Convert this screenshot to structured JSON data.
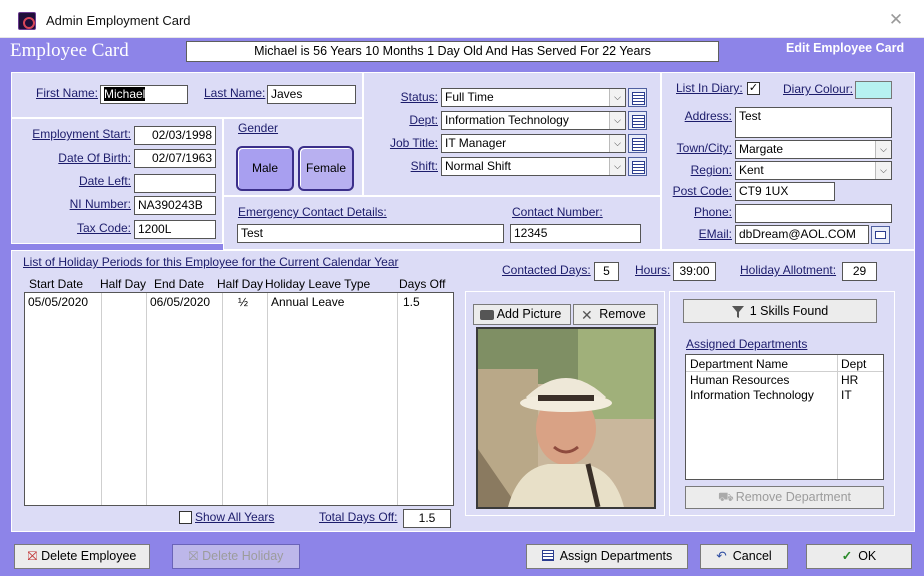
{
  "window": {
    "title": "Admin Employment Card"
  },
  "header": {
    "title": "Employee Card",
    "message": "Michael is 56 Years 10 Months 1 Day Old And Has Served For 22 Years",
    "mode": "Edit Employee Card"
  },
  "names": {
    "first_label": "First Name:",
    "first_value": "Michael",
    "last_label": "Last Name:",
    "last_value": "Javes"
  },
  "employment": {
    "start_label": "Employment Start:",
    "start_value": "02/03/1998",
    "dob_label": "Date Of Birth:",
    "dob_value": "02/07/1963",
    "left_label": "Date Left:",
    "left_value": "",
    "ni_label": "NI Number:",
    "ni_value": "NA390243B",
    "tax_label": "Tax Code:",
    "tax_value": "1200L"
  },
  "gender": {
    "label": "Gender",
    "male": "Male",
    "female": "Female",
    "selected": "Male"
  },
  "job": {
    "status_label": "Status:",
    "status_value": "Full Time",
    "dept_label": "Dept:",
    "dept_value": "Information Technology",
    "title_label": "Job Title:",
    "title_value": "IT Manager",
    "shift_label": "Shift:",
    "shift_value": "Normal Shift"
  },
  "emergency": {
    "contact_label": "Emergency Contact Details:",
    "contact_value": "Test",
    "number_label": "Contact Number:",
    "number_value": "12345"
  },
  "address": {
    "diary_label": "List In Diary:",
    "diary_checked": true,
    "colour_label": "Diary Colour:",
    "colour_value": "#b6f1f1",
    "address_label": "Address:",
    "address_value": "Test",
    "town_label": "Town/City:",
    "town_value": "Margate",
    "region_label": "Region:",
    "region_value": "Kent",
    "postcode_label": "Post Code:",
    "postcode_value": "CT9 1UX",
    "phone_label": "Phone:",
    "phone_value": "",
    "email_label": "EMail:",
    "email_value": "dbDream@AOL.COM"
  },
  "holidays": {
    "title": "List of Holiday Periods for this Employee for the Current Calendar Year",
    "columns": [
      "Start Date",
      "Half Day",
      "End Date",
      "Half Day",
      "Holiday Leave Type",
      "Days Off"
    ],
    "rows": [
      {
        "start": "05/05/2020",
        "half1": "",
        "end": "06/05/2020",
        "half2": "½",
        "type": "Annual Leave",
        "days": "1.5"
      }
    ],
    "show_all_label": "Show All Years",
    "total_label": "Total Days Off:",
    "total_value": "1.5"
  },
  "contract": {
    "days_label": "Contacted Days:",
    "days_value": "5",
    "hours_label": "Hours:",
    "hours_value": "39:00",
    "allot_label": "Holiday Allotment:",
    "allot_value": "29"
  },
  "picture": {
    "add_label": "Add Picture",
    "remove_label": "Remove"
  },
  "skills": {
    "found_label": "1 Skills Found",
    "assigned_title": "Assigned Departments",
    "columns": [
      "Department Name",
      "Dept"
    ],
    "rows": [
      {
        "name": "Human Resources",
        "code": "HR"
      },
      {
        "name": "Information Technology",
        "code": "IT"
      }
    ],
    "remove_dept_label": "Remove Department"
  },
  "footer": {
    "delete_employee": "Delete Employee",
    "delete_holiday": "Delete Holiday",
    "assign_departments": "Assign Departments",
    "cancel": "Cancel",
    "ok": "OK"
  }
}
